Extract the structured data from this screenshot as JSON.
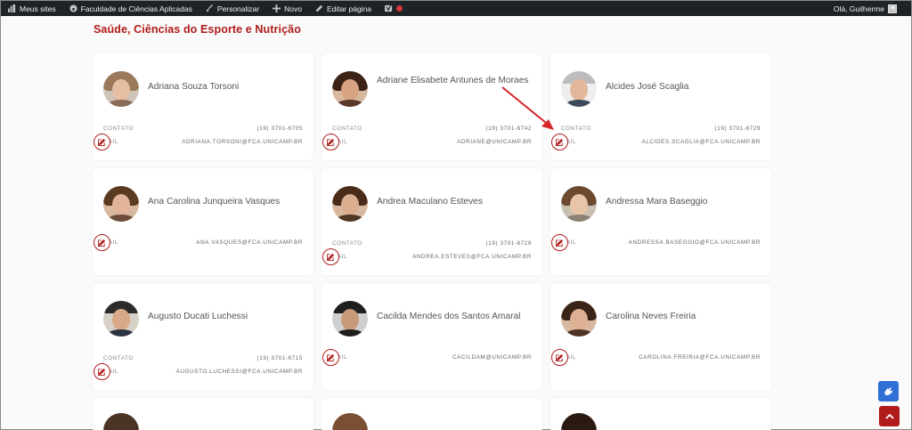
{
  "adminbar": {
    "my_sites": "Meus sites",
    "site_name": "Faculdade de Ciências Aplicadas",
    "customize": "Personalizar",
    "new": "Novo",
    "edit_page": "Editar página",
    "greeting": "Olá, Guilherme"
  },
  "section": {
    "title": "Saúde, Ciências do Esporte e Nutrição"
  },
  "labels": {
    "contact": "CONTATO",
    "mail": "MAIL"
  },
  "cards": [
    {
      "name": "Adriana Souza Torsoni",
      "phone": "(19) 3701-6705",
      "email": "ADRIANA.TORSONI@FCA.UNICAMP.BR"
    },
    {
      "name": "Adriane Elisabete Antunes de Moraes",
      "phone": "(19) 3701-6742",
      "email": "ADRIANE@UNICAMP.BR"
    },
    {
      "name": "Alcides José Scaglia",
      "phone": "(19) 3701-6729",
      "email": "ALCIDES.SCAGLIA@FCA.UNICAMP.BR"
    },
    {
      "name": "Ana Carolina Junqueira Vasques",
      "phone": "",
      "email": "ANA.VASQUES@FCA.UNICAMP.BR"
    },
    {
      "name": "Andrea Maculano Esteves",
      "phone": "(19) 3701-6729",
      "email": "ANDREA.ESTEVES@FCA.UNICAMP.BR"
    },
    {
      "name": "Andressa Mara Baseggio",
      "phone": "",
      "email": "ANDRESSA.BASEGGIO@FCA.UNICAMP.BR"
    },
    {
      "name": "Augusto Ducati Luchessi",
      "phone": "(19) 3701-6715",
      "email": "AUGUSTO.LUCHESSI@FCA.UNICAMP.BR"
    },
    {
      "name": "Cacilda Mendes dos Santos Amaral",
      "phone": "",
      "email": "CACILDAM@UNICAMP.BR"
    },
    {
      "name": "Carolina Neves Freiria",
      "phone": "",
      "email": "CAROLINA.FREIRIA@FCA.UNICAMP.BR"
    }
  ],
  "colors": {
    "accent": "#b01b1b",
    "adminbar_bg": "#1d2327",
    "accessibility_blue": "#2f6fd6"
  }
}
